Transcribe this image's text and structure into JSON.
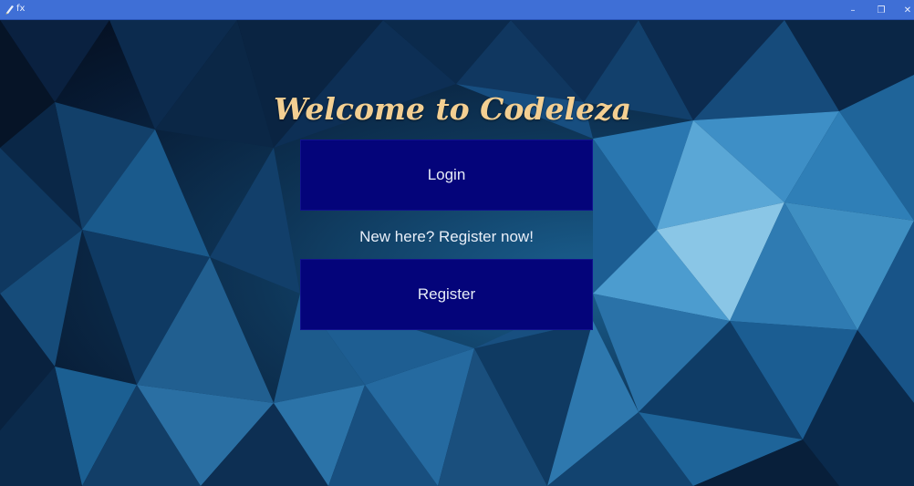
{
  "window": {
    "title": "fx",
    "controls": {
      "minimize": "–",
      "maximize": "❐",
      "close": "✕"
    },
    "icons": {
      "app": "pen-icon"
    }
  },
  "main": {
    "heading": "Welcome to Codeleza",
    "login_label": "Login",
    "register_prompt": "New here? Register now!",
    "register_label": "Register"
  },
  "colors": {
    "titlebar": "#3f6fd6",
    "heading": "#f3cf92",
    "button": "#04047a",
    "button_text": "#e6ecf7"
  }
}
